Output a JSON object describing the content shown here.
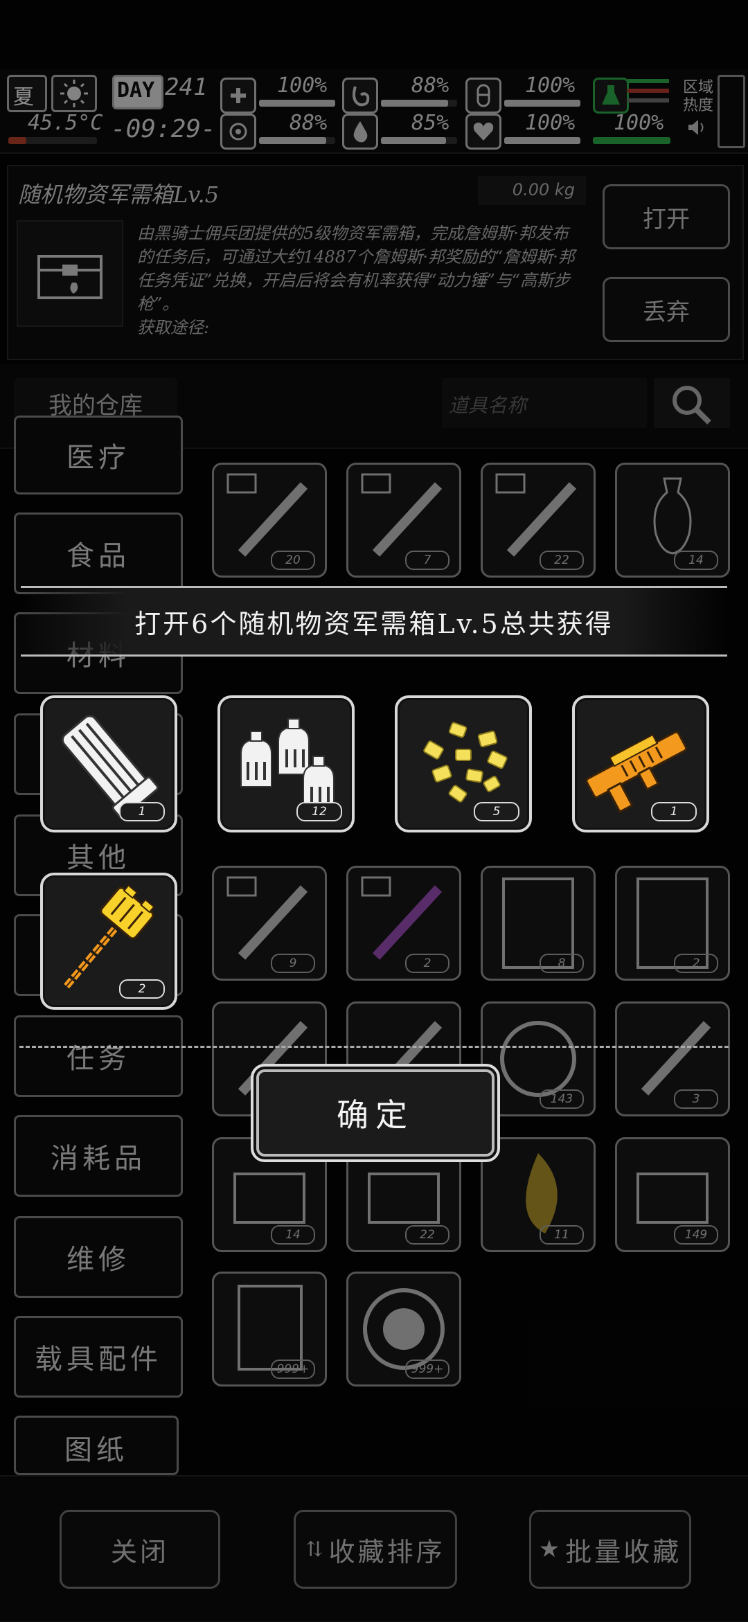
{
  "hud": {
    "season": "夏",
    "temperature": "45.5°C",
    "day_label": "DAY",
    "day_number": "241",
    "clock": "-09:29-",
    "stats": [
      {
        "name": "health",
        "value": "100%",
        "level": 1.0
      },
      {
        "name": "hunger",
        "value": "88%",
        "level": 0.88
      },
      {
        "name": "stamina",
        "value": "100%",
        "level": 1.0
      },
      {
        "name": "virus",
        "value": "88%",
        "level": 0.88
      },
      {
        "name": "thirst",
        "value": "85%",
        "level": 0.85
      },
      {
        "name": "mood",
        "value": "100%",
        "level": 1.0
      }
    ],
    "signal_value": "100%",
    "region_label": "区域热度"
  },
  "item": {
    "name": "随机物资军需箱Lv.5",
    "weight": "0.00 kg",
    "description": "由黑骑士佣兵团提供的5级物资军需箱，完成詹姆斯·邦发布的任务后，可通过大约14887个詹姆斯·邦奖励的“詹姆斯·邦任务凭证”兑换，开启后将会有机率获得“动力锤”与“高斯步枪”。",
    "source_label": "获取途径:",
    "open_button": "打开",
    "discard_button": "丢弃"
  },
  "warehouse": {
    "title": "我的仓库",
    "search_placeholder": "道具名称"
  },
  "categories": [
    "医疗",
    "食品",
    "材料",
    "其他",
    "任务",
    "消耗品",
    "维修",
    "载具配件",
    "图纸"
  ],
  "grid_counts": {
    "row1": [
      "20",
      "7",
      "22",
      "14"
    ],
    "row5": [
      "9",
      "2",
      "8",
      "2"
    ],
    "row6": [
      "",
      "",
      "143",
      "3"
    ],
    "row7": [
      "14",
      "22",
      "11",
      "149"
    ],
    "row8": [
      "999+",
      "999+"
    ]
  },
  "modal": {
    "banner": "打开6个随机物资军需箱Lv.5总共获得",
    "rewards": [
      {
        "icon": "magazine-icon",
        "count": "1"
      },
      {
        "icon": "gas-canisters-icon",
        "count": "12"
      },
      {
        "icon": "gold-nuggets-icon",
        "count": "5"
      },
      {
        "icon": "gauss-rifle-icon",
        "count": "1"
      },
      {
        "icon": "power-hammer-icon",
        "count": "2"
      }
    ],
    "confirm": "确定"
  },
  "nav": {
    "close": "关闭",
    "sort": "收藏排序",
    "batch": "批量收藏"
  }
}
